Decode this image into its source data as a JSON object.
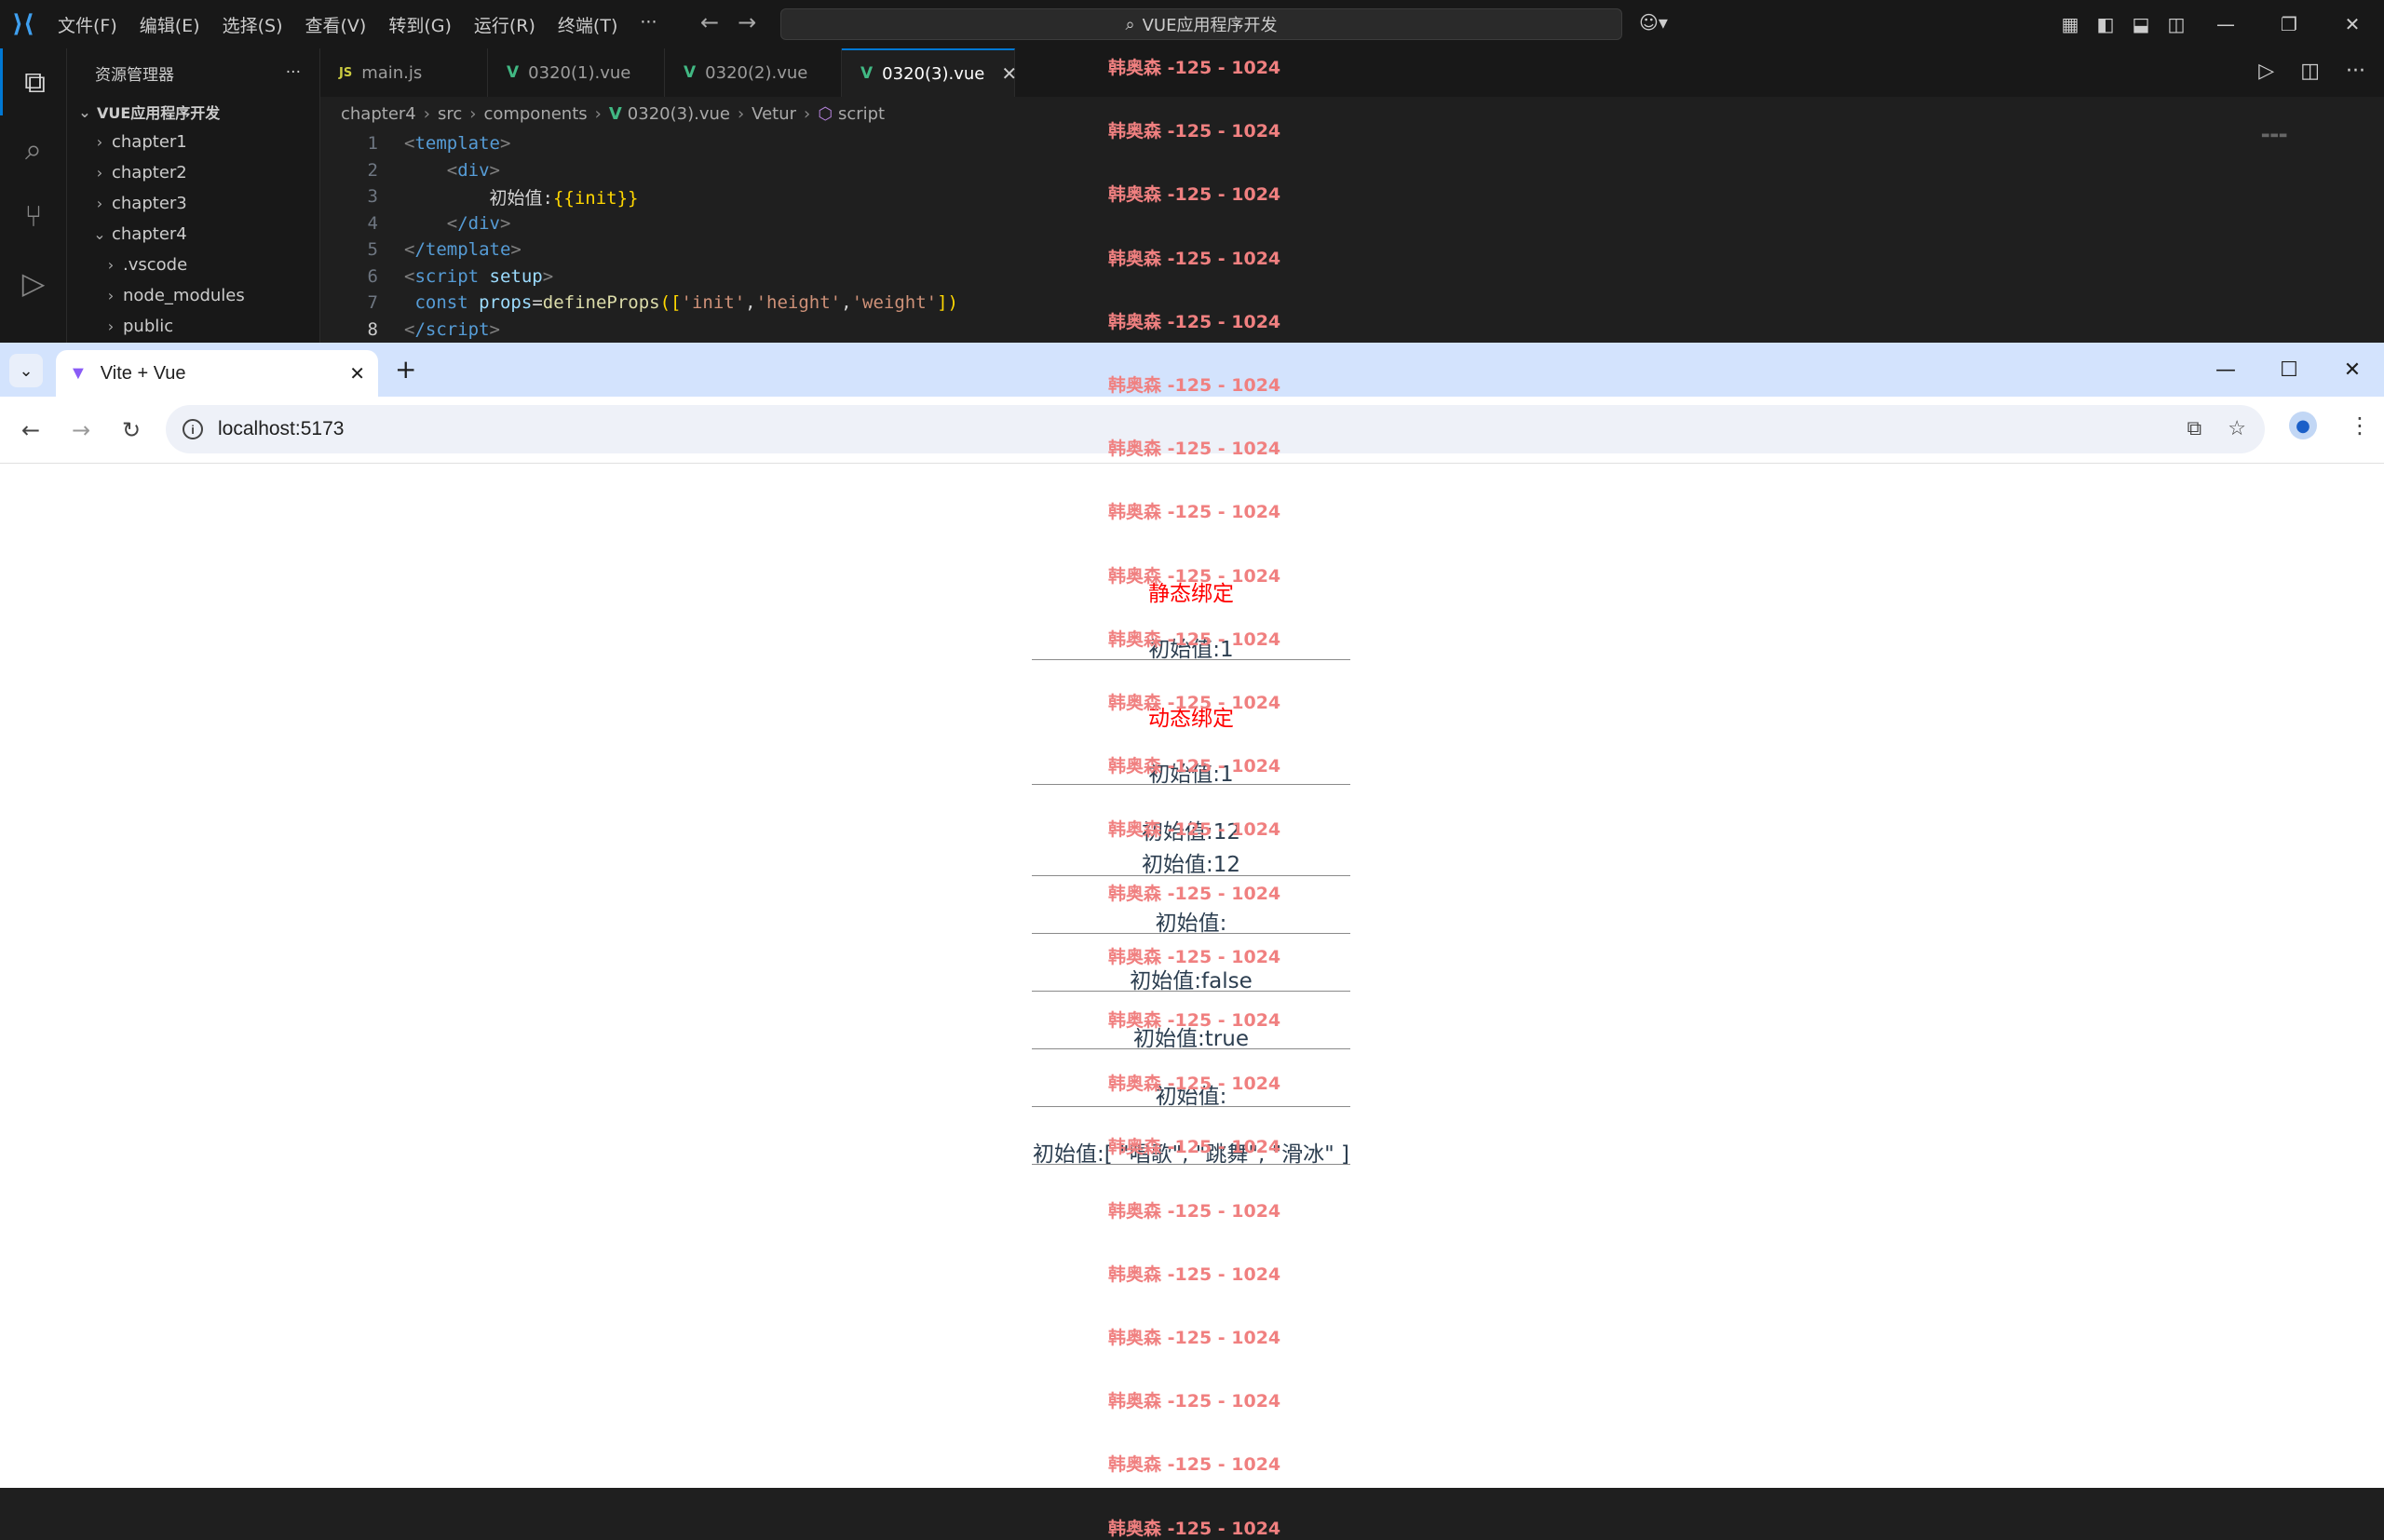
{
  "vscode": {
    "menu": [
      "文件(F)",
      "编辑(E)",
      "选择(S)",
      "查看(V)",
      "转到(G)",
      "运行(R)",
      "终端(T)",
      "···"
    ],
    "search_text": "VUE应用程序开发",
    "explorer_title": "资源管理器",
    "tree_root": "VUE应用程序开发",
    "tree": [
      {
        "label": "chapter1",
        "expanded": false,
        "depth": 1
      },
      {
        "label": "chapter2",
        "expanded": false,
        "depth": 1
      },
      {
        "label": "chapter3",
        "expanded": false,
        "depth": 1
      },
      {
        "label": "chapter4",
        "expanded": true,
        "depth": 1
      },
      {
        "label": ".vscode",
        "expanded": false,
        "depth": 2
      },
      {
        "label": "node_modules",
        "expanded": false,
        "depth": 2
      },
      {
        "label": "public",
        "expanded": false,
        "depth": 2
      }
    ],
    "tabs": [
      {
        "label": "main.js",
        "kind": "js",
        "active": false
      },
      {
        "label": "0320(1).vue",
        "kind": "vue",
        "active": false
      },
      {
        "label": "0320(2).vue",
        "kind": "vue",
        "active": false
      },
      {
        "label": "0320(3).vue",
        "kind": "vue",
        "active": true
      }
    ],
    "breadcrumbs": [
      "chapter4",
      "src",
      "components",
      "0320(3).vue",
      "Vetur",
      "script"
    ],
    "line_numbers": [
      "1",
      "2",
      "3",
      "4",
      "5",
      "6",
      "7",
      "8"
    ],
    "code": {
      "l1": "template",
      "l2": "div",
      "l3_text": "初始值:",
      "l3_expr": "{{init}}",
      "l4": "/div",
      "l5": "/template",
      "l6_tag": "script",
      "l6_attr": "setup",
      "l7_kw": "const",
      "l7_var": "props",
      "l7_fn": "defineProps",
      "l7_s1": "'init'",
      "l7_s2": "'height'",
      "l7_s3": "'weight'",
      "l8": "/script"
    },
    "current_line": "8"
  },
  "browser": {
    "tab_title": "Vite + Vue",
    "url": "localhost:5173",
    "watermark": "韩奥森 -125 - 1024",
    "page": {
      "static_heading": "静态绑定",
      "static_rows": [
        "初始值:1"
      ],
      "dynamic_heading": "动态绑定",
      "groups": [
        [
          "初始值:1"
        ],
        [
          "初始值:12",
          "初始值:12"
        ],
        [
          "初始值:"
        ],
        [
          "初始值:false"
        ],
        [
          "初始值:true"
        ],
        [
          "初始值:"
        ],
        [
          "初始值:[ \"唱歌\", \"跳舞\", \"滑冰\" ]"
        ]
      ]
    }
  }
}
